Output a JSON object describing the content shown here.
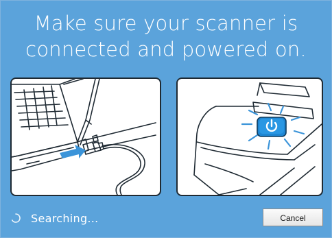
{
  "message": {
    "line1": "Make sure your scanner is",
    "line2": "connected and powered on."
  },
  "illustrations": {
    "left": "laptop-usb-connection-icon",
    "right": "scanner-power-button-icon"
  },
  "status": {
    "text": "Searching...",
    "icon": "spinner-icon"
  },
  "actions": {
    "cancel_label": "Cancel"
  },
  "colors": {
    "background": "#5ba3db",
    "power_button": "#1f86d2",
    "line_art": "#1f2a33",
    "arrow": "#3b94d9"
  }
}
